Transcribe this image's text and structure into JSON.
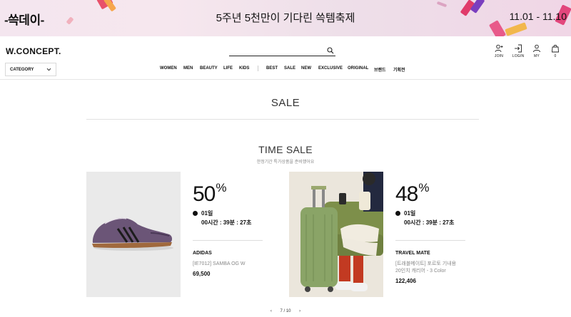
{
  "banner": {
    "logo": "-쓱데이-",
    "headline": "5주년 5천만이 기다린 쓱템축제",
    "dates": "11.01 - 11.10"
  },
  "header": {
    "brand": "W.CONCEPT.",
    "search": {
      "value": "",
      "placeholder": ""
    },
    "utils": [
      {
        "label": "JOIN",
        "icon": "person-plus-icon"
      },
      {
        "label": "LOGIN",
        "icon": "login-icon"
      },
      {
        "label": "MY",
        "icon": "person-icon"
      },
      {
        "label": "0",
        "icon": "shopping-bag-icon"
      }
    ],
    "category_label": "CATEGORY",
    "nav_left": [
      "WOMEN",
      "MEN",
      "BEAUTY",
      "LIFE",
      "KIDS"
    ],
    "nav_right": [
      "BEST",
      "SALE",
      "NEW",
      "EXCLUSIVE",
      "ORIGINAL",
      "브랜드",
      "기획전"
    ]
  },
  "page": {
    "title": "SALE",
    "section_title": "TIME SALE",
    "section_subtitle": "한정기간 특가상품을 준비했어요"
  },
  "products": [
    {
      "discount": "50",
      "pct_sign": "%",
      "days": "01일",
      "hours": "00시간",
      "minutes": "39분",
      "seconds": "27초",
      "brand": "ADIDAS",
      "name_line1": "[IE7012] SAMBA OG W",
      "name_line2": "",
      "price": "69,500"
    },
    {
      "discount": "48",
      "pct_sign": "%",
      "days": "01일",
      "hours": "00시간",
      "minutes": "39분",
      "seconds": "27초",
      "brand": "TRAVEL MATE",
      "name_line1": "[트래블메이트] 포르토 기내용",
      "name_line2": "20인치 캐리어 - 3 Color",
      "price": "122,406"
    }
  ],
  "pager": {
    "prev": "‹",
    "text": "7 / 10",
    "next": "›"
  },
  "colors": {
    "banner_bg": "#f4e6ef",
    "shoe_purple": "#6b5577",
    "suitcase_green": "#8aa467",
    "sofa_green": "#7d8f4a"
  }
}
